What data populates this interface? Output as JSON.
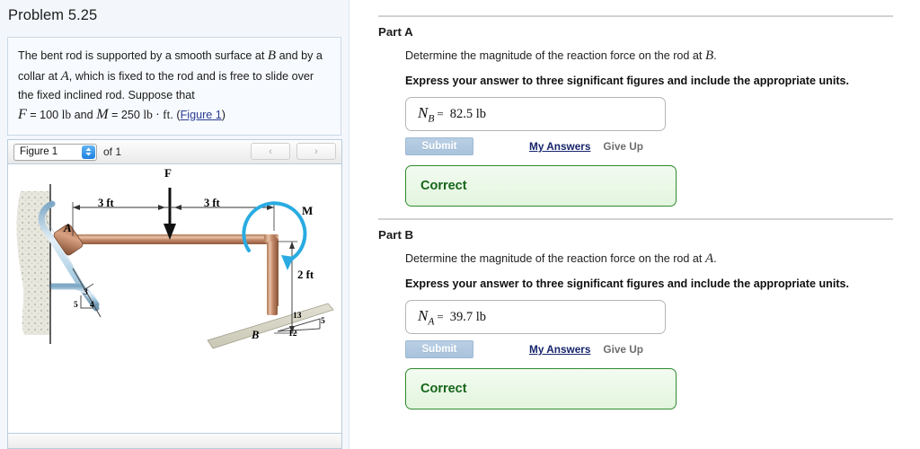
{
  "left": {
    "problem_title": "Problem 5.25",
    "statement": {
      "line1_a": "The bent rod is supported by a smooth surface at ",
      "sym_B": "B",
      "line1_b": " and",
      "line2_a": "by a collar at ",
      "sym_A": "A",
      "line2_b": ", which is fixed to the rod and is free to",
      "line3": "slide over the fixed inclined rod. Suppose that",
      "sym_F": "F",
      "eq1": "= 100",
      "unit1": "lb",
      "and": "and",
      "sym_M": "M",
      "eq2": "= 250",
      "unit2": "lb · ft",
      "period": ".",
      "paren_open": "(",
      "figure_link": "Figure 1",
      "paren_close": ")"
    },
    "figure_toolbar": {
      "select_value": "Figure 1",
      "of_label": "of 1",
      "prev_label": "‹",
      "next_label": "›",
      "dropdown_up": "▲",
      "dropdown_down": "▼"
    },
    "figure_labels": {
      "force_F": "F",
      "moment_M": "M",
      "point_A": "A",
      "point_B": "B",
      "dim_left": "3 ft",
      "dim_right": "3 ft",
      "dim_vertical": "2 ft",
      "slope_a_3": "3",
      "slope_a_4": "4",
      "slope_a_5": "5",
      "slope_b_13": "13",
      "slope_b_12": "12",
      "slope_b_5": "5"
    }
  },
  "right": {
    "parts": [
      {
        "heading": "Part A",
        "question_pre": "Determine the magnitude of the reaction force on the rod at ",
        "question_sym": "B",
        "question_post": ".",
        "instruction": "Express your answer to three significant figures and include the appropriate units.",
        "answer_symbol": "N",
        "answer_subscript": "B",
        "answer_equals": "=",
        "answer_value": "82.5 lb",
        "submit_label": "Submit",
        "my_answers_label": "My Answers",
        "give_up_label": "Give Up",
        "status_label": "Correct"
      },
      {
        "heading": "Part B",
        "question_pre": "Determine the magnitude of the reaction force on the rod at ",
        "question_sym": "A",
        "question_post": ".",
        "instruction": "Express your answer to three significant figures and include the appropriate units.",
        "answer_symbol": "N",
        "answer_subscript": "A",
        "answer_equals": "=",
        "answer_value": "39.7 lb",
        "submit_label": "Submit",
        "my_answers_label": "My Answers",
        "give_up_label": "Give Up",
        "status_label": "Correct"
      }
    ]
  },
  "colors": {
    "panel_bg": "#f3f7fc",
    "link": "#2a3c94",
    "submit_bg": "#b0c8e0",
    "correct_border": "#2e8b2e",
    "correct_text": "#16651a",
    "rod": "#c08868",
    "support_rod": "#9dc6e0",
    "moment_arrow": "#29abe2"
  }
}
